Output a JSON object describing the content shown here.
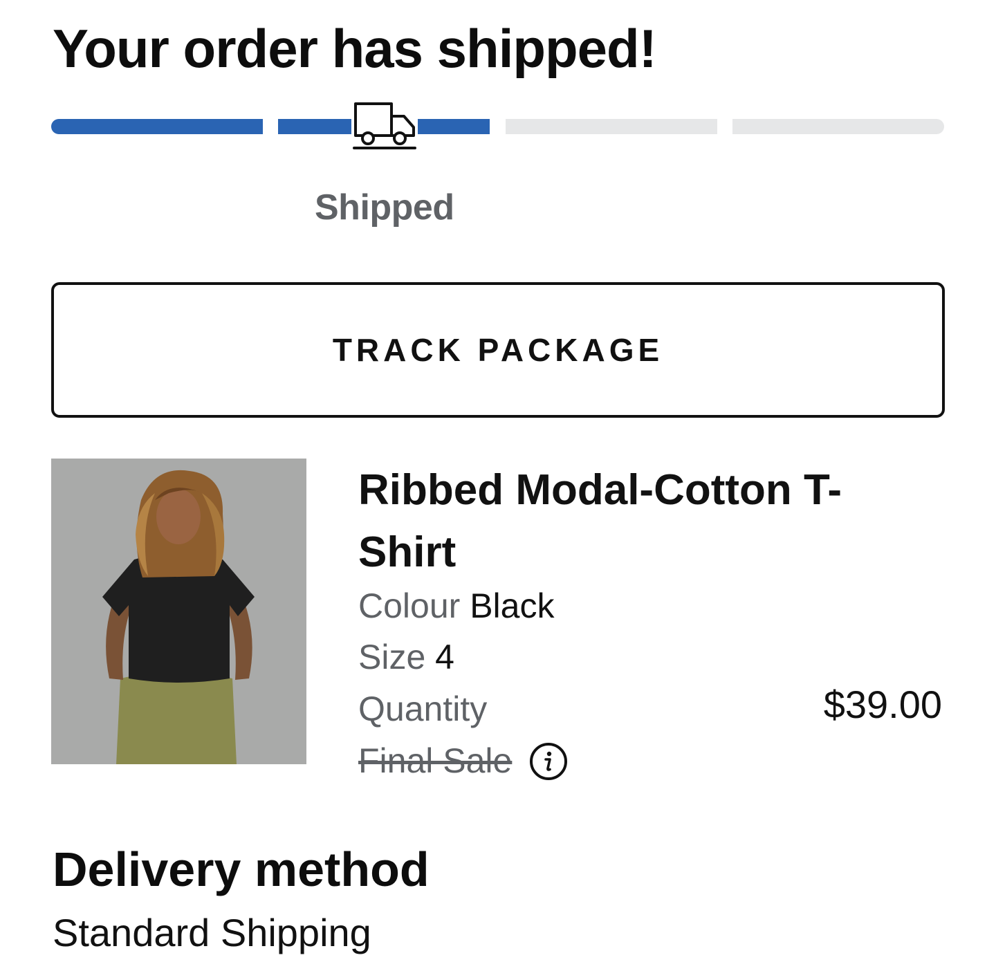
{
  "header": {
    "title": "Your order has shipped!"
  },
  "progress": {
    "total_steps": 4,
    "completed_steps": 2,
    "current_step_label": "Shipped",
    "active_color": "#2a64b3",
    "inactive_color": "#e6e7e8",
    "current_icon": "truck-icon"
  },
  "actions": {
    "track_package_label": "TRACK PACKAGE"
  },
  "product": {
    "name": "Ribbed Modal-Cotton T-Shirt",
    "image_icon": "product-photo",
    "colour_label": "Colour",
    "colour_value": "Black",
    "size_label": "Size",
    "size_value": "4",
    "quantity_label": "Quantity",
    "final_sale_label": "Final Sale",
    "info_icon": "info-icon",
    "price": "$39.00"
  },
  "delivery": {
    "title": "Delivery method",
    "method": "Standard Shipping"
  }
}
